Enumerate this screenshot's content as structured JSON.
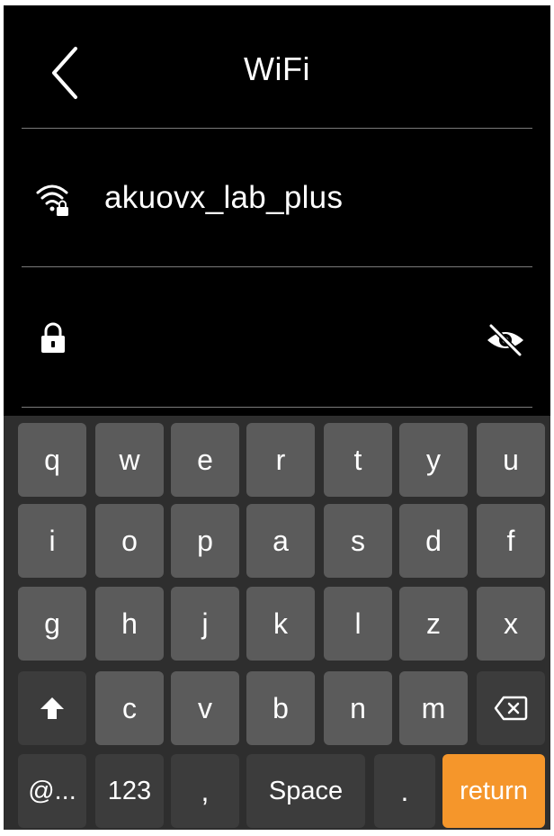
{
  "header": {
    "title": "WiFi"
  },
  "network": {
    "ssid": "akuovx_lab_plus"
  },
  "password": {
    "value": "",
    "placeholder": ""
  },
  "keyboard": {
    "row1": [
      "q",
      "w",
      "e",
      "r",
      "t",
      "y",
      "u"
    ],
    "row2": [
      "i",
      "o",
      "p",
      "a",
      "s",
      "d",
      "f"
    ],
    "row3": [
      "g",
      "h",
      "j",
      "k",
      "l",
      "z",
      "x"
    ],
    "row4": [
      "c",
      "v",
      "b",
      "n",
      "m"
    ],
    "row5": {
      "symbols": "@...",
      "numbers": "123",
      "comma": ",",
      "space": "Space",
      "period": ".",
      "return": "return"
    }
  },
  "colors": {
    "background": "#000000",
    "key": "#5b5b5b",
    "key_dark": "#3c3c3c",
    "return": "#f5962b"
  },
  "icons": [
    "back-arrow-icon",
    "wifi-lock-icon",
    "lock-icon",
    "eye-slash-icon",
    "shift-icon",
    "backspace-icon"
  ]
}
